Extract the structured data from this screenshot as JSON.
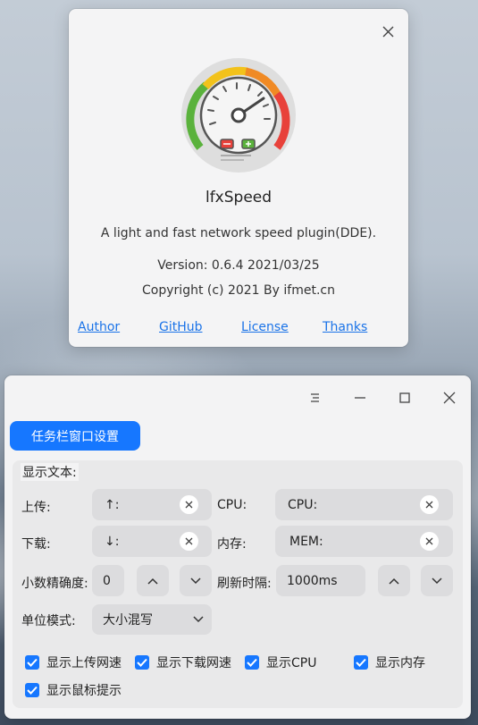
{
  "about": {
    "app_name": "lfxSpeed",
    "description": "A light and fast network speed plugin(DDE).",
    "version": "Version: 0.6.4  2021/03/25",
    "copyright": "Copyright (c) 2021 By ifmet.cn",
    "links": {
      "author": "Author",
      "github": "GitHub",
      "license": "License",
      "thanks": "Thanks"
    }
  },
  "settings": {
    "tab": "任务栏窗口设置",
    "section_title": "显示文本:",
    "upload_label": "上传:",
    "upload_value": "↑:",
    "cpu_label": "CPU:",
    "cpu_value": "CPU:",
    "download_label": "下载:",
    "download_value": "↓:",
    "mem_label": "内存:",
    "mem_value": "MEM:",
    "precision_label": "小数精确度:",
    "precision_value": "0",
    "refresh_label": "刷新时隔:",
    "refresh_value": "1000ms",
    "unit_label": "单位模式:",
    "unit_value": "大小混写",
    "checkboxes": [
      {
        "label": "显示上传网速",
        "checked": true
      },
      {
        "label": "显示下载网速",
        "checked": true
      },
      {
        "label": "显示CPU",
        "checked": true
      },
      {
        "label": "显示内存",
        "checked": true
      },
      {
        "label": "显示鼠标提示",
        "checked": true
      }
    ]
  },
  "colors": {
    "accent": "#1677ff",
    "link": "#1a73e8"
  }
}
